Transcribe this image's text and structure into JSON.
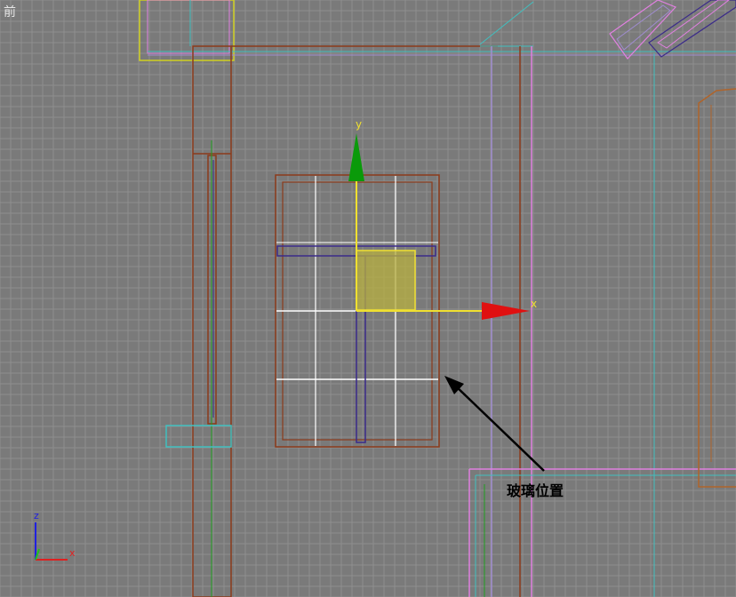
{
  "viewport": {
    "label": "前",
    "background": "#7a7a7a",
    "grid_minor_color": "#8e8e8e",
    "grid_major_color": "#a6a6a6"
  },
  "gizmo": {
    "x_label": "x",
    "y_label": "y",
    "x_color": "#e01010",
    "y_color": "#0a9a0a",
    "axis_line_color": "#f0e030"
  },
  "axis_tripod": {
    "z_label": "z",
    "x_label": "x",
    "z_color": "#2020e0",
    "x_color": "#e02020",
    "y_color": "#20c020"
  },
  "annotation": {
    "text": "玻璃位置",
    "arrow_color": "#000000"
  },
  "colors": {
    "brown": "#8b3a1a",
    "cyan": "#40c0c0",
    "pink": "#e080e0",
    "purple": "#3a2a8a",
    "yellow": "#d0d020",
    "orange": "#b0642a",
    "white_grid": "#ffffff",
    "lavender": "#a08cd0"
  }
}
